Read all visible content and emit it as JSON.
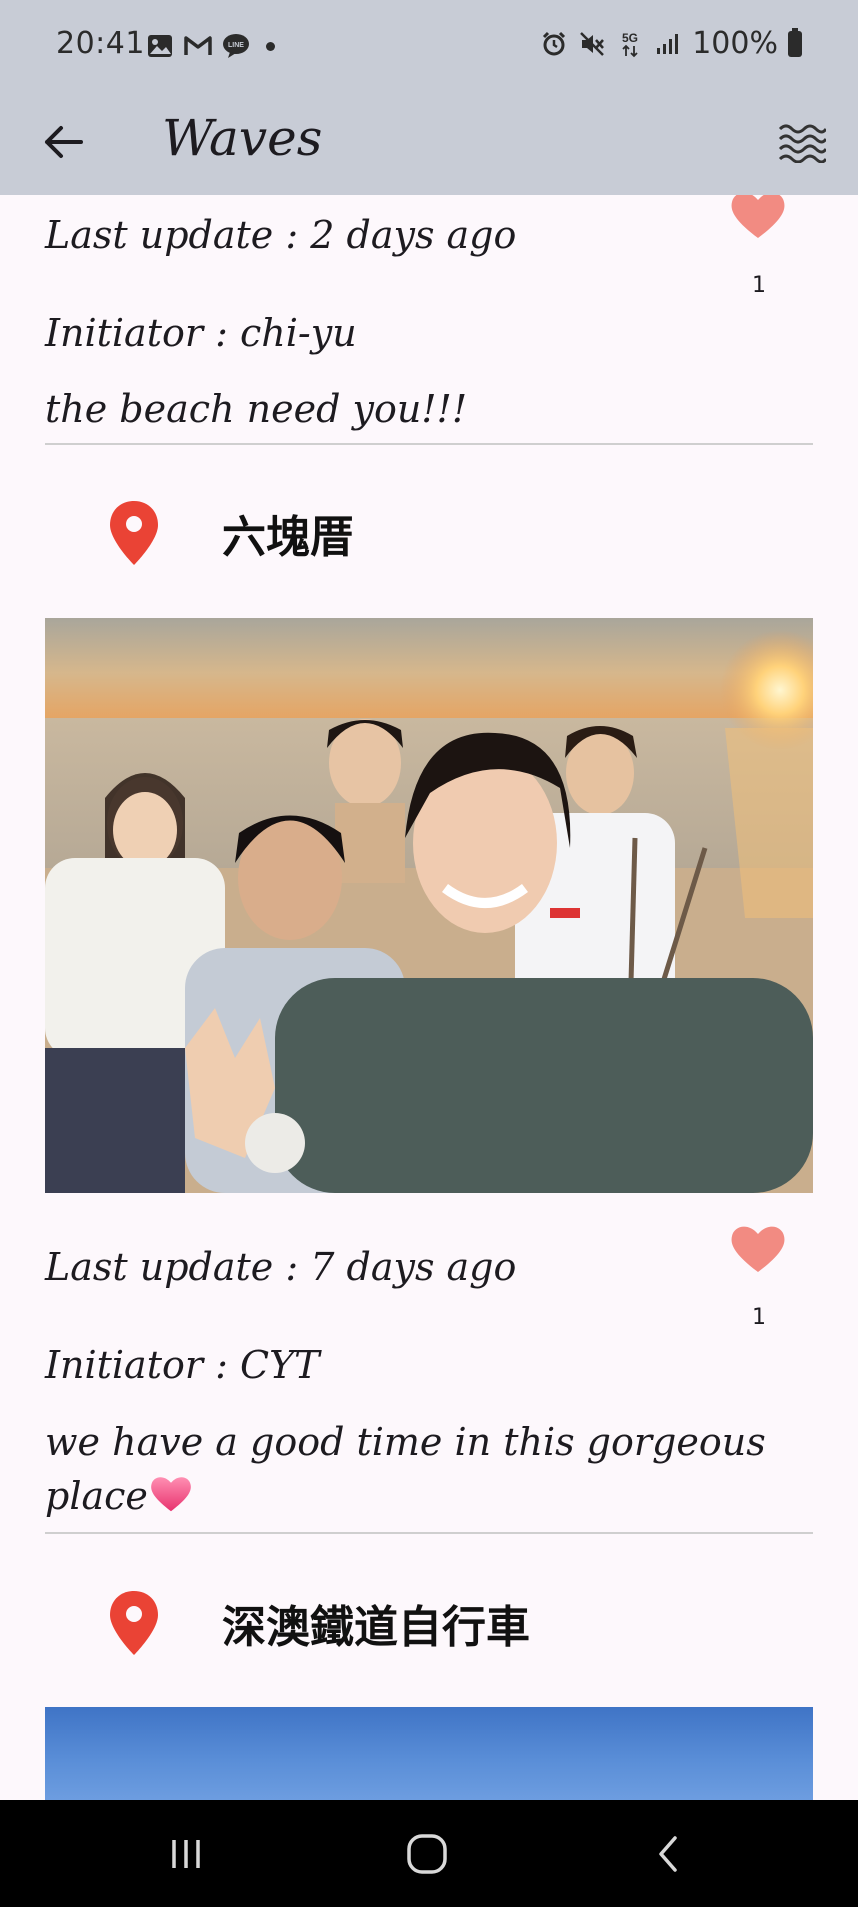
{
  "status_bar": {
    "time": "20:41",
    "battery": "100%",
    "left_icons": [
      "gallery-icon",
      "gmail-icon",
      "line-icon",
      "dot"
    ],
    "right_icons": [
      "alarm-icon",
      "mute-icon",
      "5g-icon",
      "signal-icon",
      "battery-icon"
    ]
  },
  "app_bar": {
    "title": "Waves",
    "back_icon": "arrow-left-icon",
    "menu_icon": "waves-icon",
    "background": "#c8ccd6"
  },
  "posts": [
    {
      "last_update": "Last update : 2 days ago",
      "initiator": "Initiator : chi-yu",
      "message": "the beach need you!!!",
      "likes": "1"
    },
    {
      "location": "六塊厝",
      "last_update": "Last update : 7 days ago",
      "initiator": "Initiator : CYT",
      "message": "we have a good time in this gorgeous place",
      "likes": "1"
    },
    {
      "location": "深澳鐵道自行車"
    }
  ],
  "colors": {
    "heart": "#f28b82",
    "pin": "#ea4335",
    "divider": "#cfcfcf",
    "page_bg": "#fdf8fc"
  },
  "nav_bar": {
    "recents_icon": "recents-icon",
    "home_icon": "home-icon",
    "back_icon": "back-icon"
  }
}
